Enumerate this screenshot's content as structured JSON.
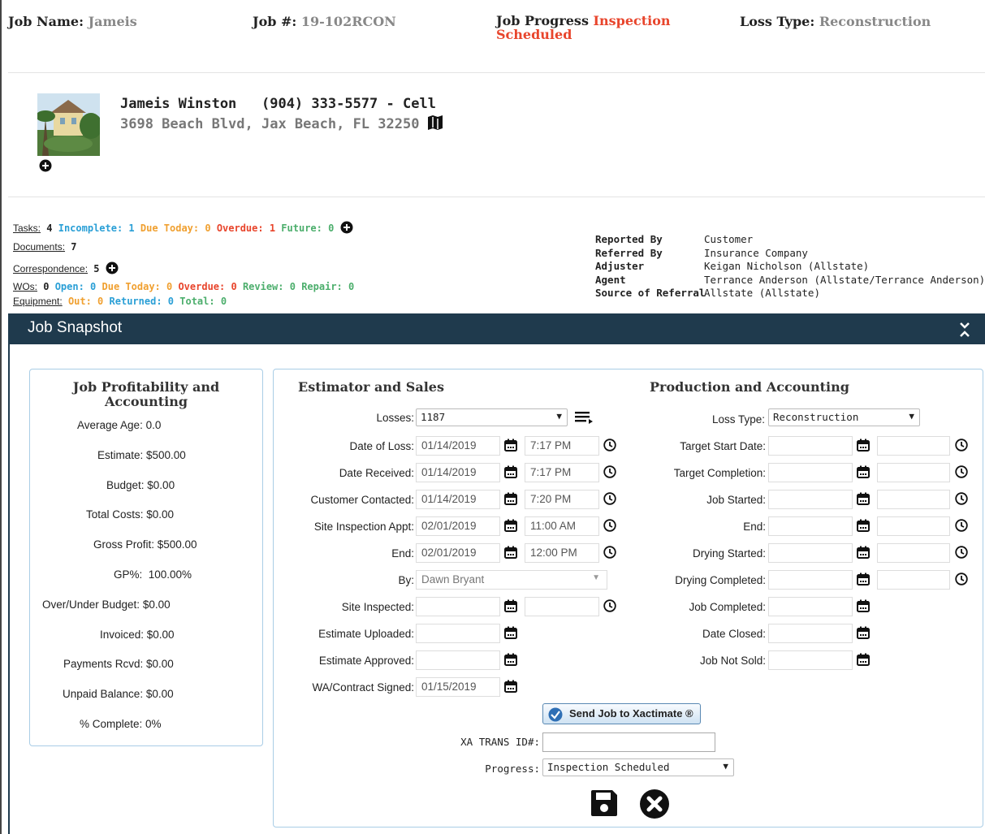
{
  "header": {
    "job_name_label": "Job Name:",
    "job_name": "Jameis",
    "job_no_label": "Job #:",
    "job_no": "19-102RCON",
    "progress_label": "Job Progress",
    "progress_value_1": "Inspection",
    "progress_value_2": "Scheduled",
    "loss_type_label": "Loss Type:",
    "loss_type": "Reconstruction"
  },
  "customer": {
    "name_phone": "Jameis Winston   (904) 333-5577 - Cell",
    "address": "3698 Beach Blvd, Jax Beach, FL 32250"
  },
  "stats": {
    "tasks_label": "Tasks:",
    "tasks": "4",
    "tasks_incomplete": "Incomplete: 1",
    "tasks_due": "Due Today: 0",
    "tasks_overdue": "Overdue: 1",
    "tasks_future": "Future: 0",
    "docs_label": "Documents:",
    "docs": "7",
    "corr_label": "Correspondence:",
    "corr": "5",
    "wos_label": "WOs:",
    "wos": "0",
    "wos_open": "Open: 0",
    "wos_due": "Due Today: 0",
    "wos_overdue": "Overdue: 0",
    "wos_review": "Review: 0",
    "wos_repair": "Repair: 0",
    "equip_label": "Equipment:",
    "equip_out": "Out: 0",
    "equip_returned": "Returned: 0",
    "equip_total": "Total: 0"
  },
  "referral": [
    {
      "label": "Reported By",
      "value": "Customer"
    },
    {
      "label": "Referred By",
      "value": "Insurance Company"
    },
    {
      "label": "Adjuster",
      "value": "Keigan Nicholson (Allstate)"
    },
    {
      "label": "Agent",
      "value": "Terrance Anderson (Allstate/Terrance Anderson)"
    },
    {
      "label": "Source of Referral",
      "value": "Allstate (Allstate)"
    }
  ],
  "snapshot_title": "Job Snapshot",
  "profit": {
    "title_1": "Job Profitability and",
    "title_2": "Accounting",
    "rows": [
      "Average Age: 0.0",
      "Estimate: $500.00",
      "Budget: $0.00",
      "Total Costs: $0.00",
      "Gross Profit: $500.00",
      "GP%:  100.00%",
      "Over/Under Budget: $0.00",
      "Invoiced: $0.00",
      "Payments Rcvd: $0.00",
      "Unpaid Balance: $0.00",
      "% Complete: 0%"
    ]
  },
  "estimator": {
    "title": "Estimator and Sales",
    "losses_label": "Losses:",
    "losses_value": "1187",
    "date_of_loss_label": "Date of Loss:",
    "date_of_loss": "01/14/2019",
    "date_of_loss_time": "7:17 PM",
    "date_received_label": "Date Received:",
    "date_received": "01/14/2019",
    "date_received_time": "7:17 PM",
    "customer_contacted_label": "Customer Contacted:",
    "customer_contacted": "01/14/2019",
    "customer_contacted_time": "7:20 PM",
    "site_inspection_label": "Site Inspection Appt:",
    "site_inspection": "02/01/2019",
    "site_inspection_time": "11:00 AM",
    "end_label": "End:",
    "end": "02/01/2019",
    "end_time": "12:00 PM",
    "by_label": "By:",
    "by": "Dawn Bryant",
    "site_inspected_label": "Site Inspected:",
    "estimate_uploaded_label": "Estimate Uploaded:",
    "estimate_approved_label": "Estimate Approved:",
    "wa_label": "WA/Contract Signed:",
    "wa": "01/15/2019",
    "send_button": "Send Job to Xactimate ®",
    "xa_label": "XA TRANS ID#:",
    "progress_label": "Progress:",
    "progress_value": "Inspection Scheduled"
  },
  "production": {
    "title": "Production and Accounting",
    "loss_type_label": "Loss Type:",
    "loss_type": "Reconstruction",
    "fields": [
      "Target Start Date:",
      "Target Completion:",
      "Job Started:",
      "End:",
      "Drying Started:",
      "Drying Completed:",
      "Job Completed:",
      "Date Closed:",
      "Job Not Sold:"
    ]
  },
  "colors": {
    "accent_blue": "#2a9fd6",
    "overdue_red": "#e8452c",
    "due_orange": "#f0a030",
    "ok_green": "#4cae6c",
    "snapshot_bar": "#1f3a4d",
    "panel_border": "#a9cde6"
  }
}
